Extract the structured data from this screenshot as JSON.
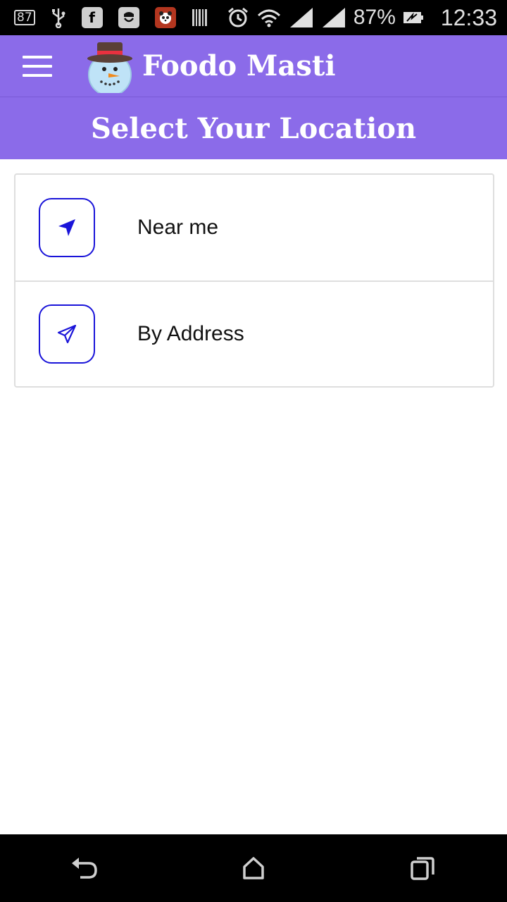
{
  "status_bar": {
    "badge": "87",
    "battery": "87%",
    "time": "12:33",
    "icons": [
      "notification-87-icon",
      "usb-icon",
      "facebook-icon",
      "phone-app-icon",
      "panda-app-icon",
      "barcode-icon",
      "alarm-icon",
      "wifi-icon",
      "signal-icon",
      "signal-icon",
      "battery-icon"
    ]
  },
  "app_bar": {
    "title": "Foodo Masti",
    "logo": "snowman-logo"
  },
  "header": {
    "title": "Select Your Location"
  },
  "options": [
    {
      "label": "Near me",
      "icon": "navigation-arrow-icon"
    },
    {
      "label": "By Address",
      "icon": "send-icon"
    }
  ],
  "colors": {
    "primary": "#8b6be9",
    "icon_accent": "#1a14d9",
    "text": "#111111"
  },
  "nav_bar": {
    "icons": [
      "back-icon",
      "home-icon",
      "recents-icon"
    ]
  }
}
